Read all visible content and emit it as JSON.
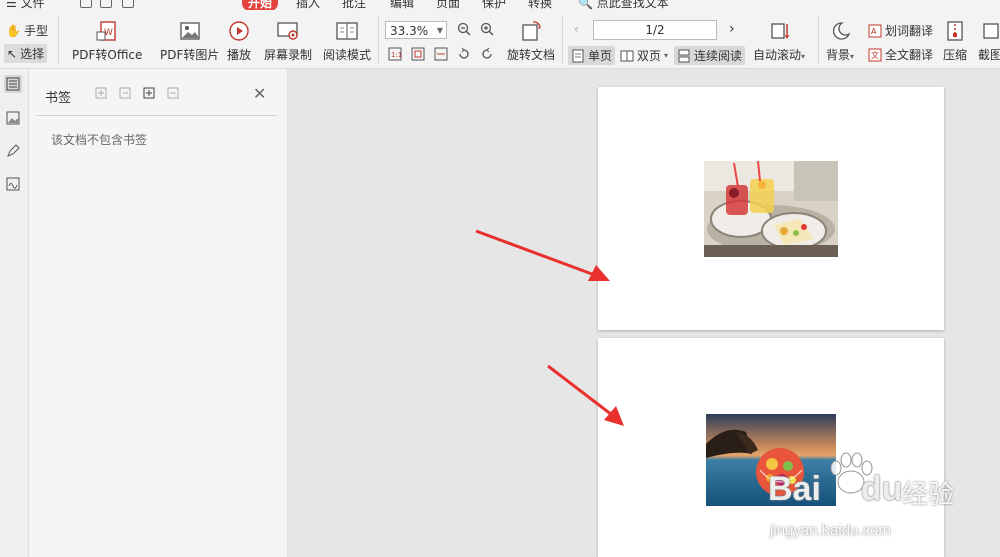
{
  "menubar": {
    "items": [
      "文件",
      "开始",
      "插入",
      "批注",
      "编辑",
      "页面",
      "保护",
      "转换"
    ],
    "active": "开始",
    "search_placeholder": "点此查找文本"
  },
  "ribbon": {
    "hand_label": "手型",
    "select_label": "选择",
    "pdf_to_office": "PDF转Office",
    "pdf_to_image": "PDF转图片",
    "play": "播放",
    "screen_record": "屏幕录制",
    "reading_mode": "阅读模式",
    "zoom": "33.3%",
    "rotate_doc": "旋转文档",
    "page_indicator": "1/2",
    "single_page": "单页",
    "double_page": "双页",
    "continuous": "连续阅读",
    "auto_scroll": "自动滚动",
    "background": "背景",
    "word_translate": "划词翻译",
    "full_translate": "全文翻译",
    "compress": "压缩",
    "screenshot": "截图"
  },
  "bookmark_panel": {
    "title": "书签",
    "empty_text": "该文档不包含书签"
  },
  "watermark": {
    "brand": "Bai",
    "brand_suffix": "du",
    "cn_text": "经验",
    "url": "jingyan.baidu.com"
  },
  "colors": {
    "accent": "#e2433c",
    "arrow": "#e8302c"
  }
}
